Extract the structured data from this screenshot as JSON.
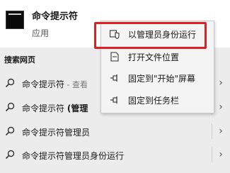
{
  "best_match": {
    "app_name": "命令提示符",
    "app_type": "应用",
    "icon": "command-prompt-icon"
  },
  "web_section": {
    "header": "搜索网页",
    "results": [
      {
        "text": "命令提示符",
        "extra": " - 查看",
        "bold": ""
      },
      {
        "text": "命令提示符 ",
        "extra": "",
        "bold": "(管理"
      },
      {
        "text": "命令提示符管理员",
        "extra": "",
        "bold": ""
      },
      {
        "text": "命令提示符管理员身份运行",
        "extra": "",
        "bold": ""
      }
    ]
  },
  "context_menu": {
    "items": [
      {
        "label": "以管理员身份运行",
        "icon": "admin-shield-icon"
      },
      {
        "label": "打开文件位置",
        "icon": "file-location-icon"
      },
      {
        "label": "固定到\"开始\"屏幕",
        "icon": "pin-icon"
      },
      {
        "label": "固定到任务栏",
        "icon": "pin-icon"
      }
    ]
  },
  "colors": {
    "highlight": "#e02020",
    "panel_bg": "#ececec",
    "menu_bg": "#f4f4f4"
  }
}
